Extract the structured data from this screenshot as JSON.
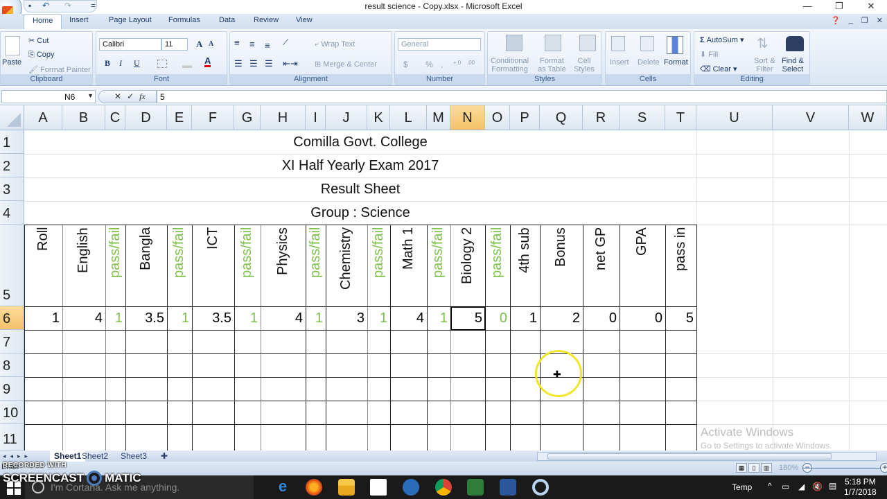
{
  "window": {
    "title": "result science - Copy.xlsx - Microsoft Excel",
    "controls": {
      "minimize": "—",
      "restore": "❐",
      "close": "✕"
    }
  },
  "quick_access": {
    "save_icon": "💾",
    "undo_icon": "↶",
    "redo_icon": "↷",
    "customize": "="
  },
  "ribbon_tabs": [
    "Home",
    "Insert",
    "Page Layout",
    "Formulas",
    "Data",
    "Review",
    "View"
  ],
  "active_tab": "Home",
  "ribbon": {
    "clipboard": {
      "label": "Clipboard",
      "paste": "Paste",
      "cut": "Cut",
      "copy": "Copy",
      "format_painter": "Format Painter"
    },
    "font": {
      "label": "Font",
      "font_name": "Calibri",
      "font_size": "11",
      "bold": "B",
      "italic": "I",
      "underline": "U",
      "grow": "A",
      "shrink": "A",
      "font_color": "#e00000"
    },
    "alignment": {
      "label": "Alignment",
      "wrap_text": "Wrap Text",
      "merge_center": "Merge & Center"
    },
    "number": {
      "label": "Number",
      "format": "General",
      "currency": "$",
      "percent": "%",
      "comma": ",",
      "inc_decimal": "+.0 .00",
      "dec_decimal": ".00 →.0"
    },
    "styles": {
      "label": "Styles",
      "conditional_formatting": [
        "Conditional",
        "Formatting"
      ],
      "format_as_table": [
        "Format",
        "as Table"
      ],
      "cell_styles": [
        "Cell",
        "Styles"
      ]
    },
    "cells": {
      "label": "Cells",
      "insert": "Insert",
      "delete": "Delete",
      "format": "Format"
    },
    "editing": {
      "label": "Editing",
      "autosum": "AutoSum",
      "fill": "Fill",
      "clear": "Clear",
      "sort_filter": [
        "Sort &",
        "Filter"
      ],
      "find_select": [
        "Find &",
        "Select"
      ]
    }
  },
  "formula_bar": {
    "name_box": "N6",
    "cancel": "✕",
    "enter": "✓",
    "fx": "fx",
    "value": "5"
  },
  "columns": [
    "A",
    "B",
    "C",
    "D",
    "E",
    "F",
    "G",
    "H",
    "I",
    "J",
    "K",
    "L",
    "M",
    "N",
    "O",
    "P",
    "Q",
    "R",
    "S",
    "T",
    "U",
    "V",
    "W"
  ],
  "selected_column": "N",
  "rows": [
    "1",
    "2",
    "3",
    "4",
    "5",
    "6",
    "7",
    "8",
    "9",
    "10",
    "11"
  ],
  "selected_row": "6",
  "sheet": {
    "titles": [
      "Comilla Govt. College",
      "XI Half Yearly Exam 2017",
      "Result Sheet",
      "Group : Science"
    ],
    "headers": [
      "Roll",
      "English",
      "pass/fail",
      "Bangla",
      "pass/fail",
      "ICT",
      "pass/fail",
      "Physics",
      "pass/fail",
      "Chemistry",
      "pass/fail",
      "Math 1",
      "pass/fail",
      "Biology 2",
      "pass/fail",
      "4th sub",
      "Bonus",
      "net GP",
      "GPA",
      "pass in"
    ],
    "header_is_passfail": [
      false,
      false,
      true,
      false,
      true,
      false,
      true,
      false,
      true,
      false,
      true,
      false,
      true,
      false,
      true,
      false,
      false,
      false,
      false,
      false
    ],
    "row6": [
      "1",
      "4",
      "1",
      "3.5",
      "1",
      "3.5",
      "1",
      "4",
      "1",
      "3",
      "1",
      "4",
      "1",
      "5",
      "0",
      "1",
      "2",
      "0",
      "0",
      "5"
    ],
    "passfail_color": "#7cbf4a"
  },
  "sheet_tabs": [
    "Sheet1",
    "Sheet2",
    "Sheet3"
  ],
  "active_sheet": "Sheet1",
  "status": {
    "mode": "Enter",
    "zoom": "180%"
  },
  "watermark": {
    "line1": "RECORDED WITH",
    "line2a": "SCREENCAST",
    "line2b": "MATIC"
  },
  "activation": {
    "title": "Activate Windows",
    "subtitle": "Go to Settings to activate Windows."
  },
  "taskbar": {
    "cortana_placeholder": "I'm Cortana. Ask me anything.",
    "apps": [
      "edge",
      "firefox",
      "file-explorer",
      "store",
      "imo",
      "chrome",
      "excel",
      "word",
      "cortana-app"
    ],
    "tray_label": "Temp",
    "time": "5:18 PM",
    "date": "1/7/2018"
  }
}
